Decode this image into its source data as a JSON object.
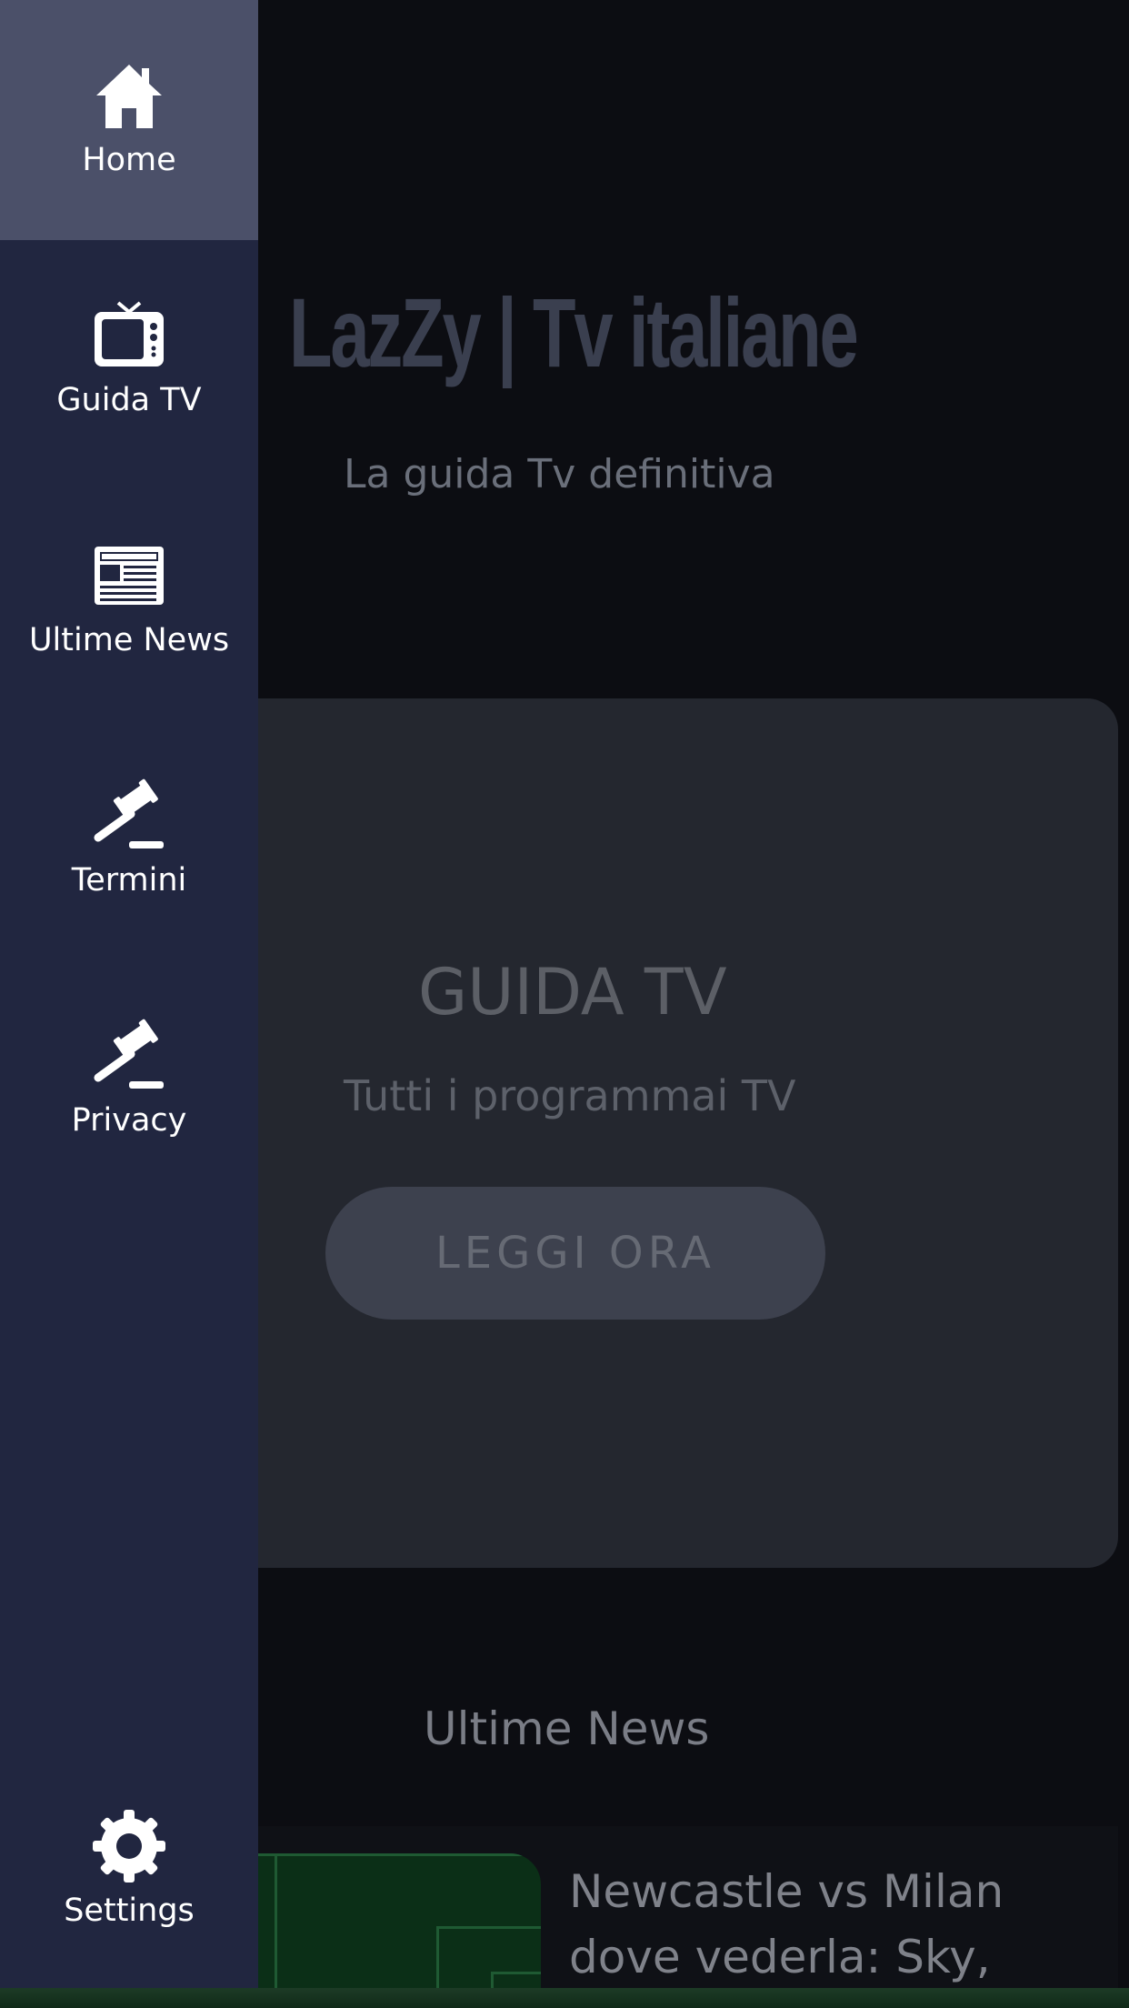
{
  "header": {
    "title": "LazZy | Tv italiane",
    "subtitle": "La guida Tv definitiva"
  },
  "hero": {
    "title": "GUIDA TV",
    "subtitle": "Tutti i programmai TV",
    "button_label": "LEGGI ORA"
  },
  "news": {
    "heading": "Ultime News",
    "items": [
      {
        "title": "Newcastle vs Milan dove vederla: Sky,"
      }
    ]
  },
  "drawer": {
    "items": [
      {
        "label": "Home",
        "icon": "home-icon",
        "active": true
      },
      {
        "label": "Guida TV",
        "icon": "tv-icon",
        "active": false
      },
      {
        "label": "Ultime News",
        "icon": "newspaper-icon",
        "active": false
      },
      {
        "label": "Termini",
        "icon": "gavel-icon",
        "active": false
      },
      {
        "label": "Privacy",
        "icon": "gavel-icon",
        "active": false
      },
      {
        "label": "Settings",
        "icon": "gear-icon",
        "active": false
      }
    ]
  },
  "colors": {
    "drawer_bg": "#212640",
    "drawer_active": "#4b5069",
    "page_bg": "#0c0d12",
    "card_bg": "#24272f"
  }
}
